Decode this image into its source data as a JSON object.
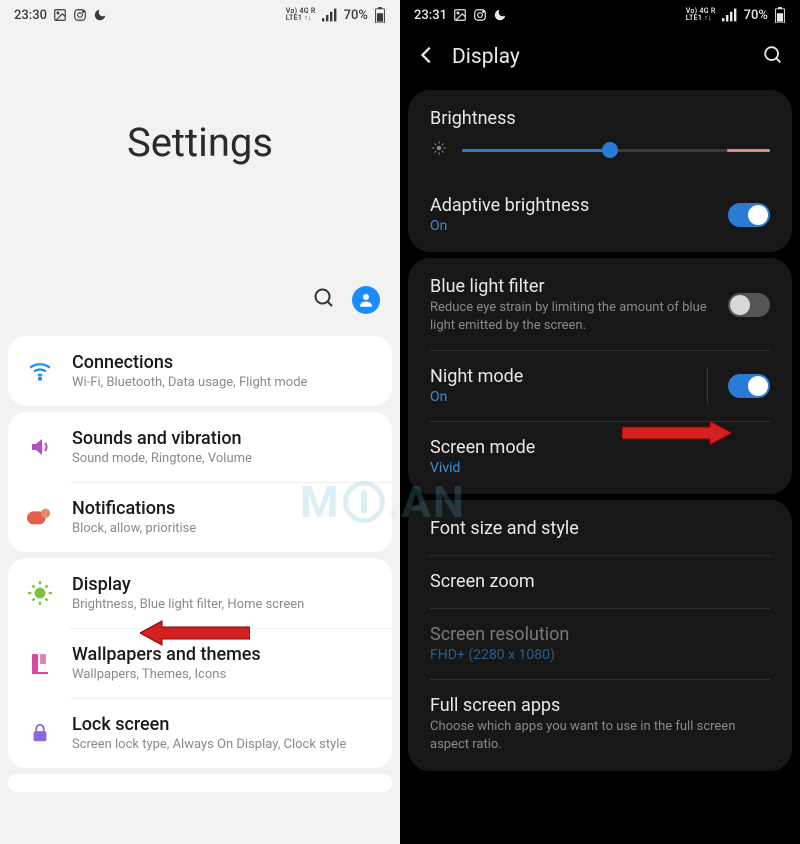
{
  "left": {
    "statusbar": {
      "time": "23:30",
      "net": "VoLTE 4G R",
      "battery": "70%"
    },
    "title": "Settings",
    "items": [
      {
        "title": "Connections",
        "sub": "Wi-Fi, Bluetooth, Data usage, Flight mode"
      },
      {
        "title": "Sounds and vibration",
        "sub": "Sound mode, Ringtone, Volume"
      },
      {
        "title": "Notifications",
        "sub": "Block, allow, prioritise"
      },
      {
        "title": "Display",
        "sub": "Brightness, Blue light filter, Home screen"
      },
      {
        "title": "Wallpapers and themes",
        "sub": "Wallpapers, Themes, Icons"
      },
      {
        "title": "Lock screen",
        "sub": "Screen lock type, Always On Display, Clock style"
      }
    ]
  },
  "right": {
    "statusbar": {
      "time": "23:31",
      "net": "VoLTE 4G R",
      "battery": "70%"
    },
    "title": "Display",
    "brightness_label": "Brightness",
    "brightness_percent": 48,
    "adaptive": {
      "title": "Adaptive brightness",
      "status": "On",
      "on": true
    },
    "bluefilter": {
      "title": "Blue light filter",
      "desc": "Reduce eye strain by limiting the amount of blue light emitted by the screen.",
      "on": false
    },
    "nightmode": {
      "title": "Night mode",
      "status": "On",
      "on": true
    },
    "screenmode": {
      "title": "Screen mode",
      "status": "Vivid"
    },
    "fontsize": {
      "title": "Font size and style"
    },
    "screenzoom": {
      "title": "Screen zoom"
    },
    "resolution": {
      "title": "Screen resolution",
      "status": "FHD+ (2280 x 1080)"
    },
    "fullscreen": {
      "title": "Full screen apps",
      "desc": "Choose which apps you want to use in the full screen aspect ratio."
    }
  },
  "watermark": "M  AN"
}
